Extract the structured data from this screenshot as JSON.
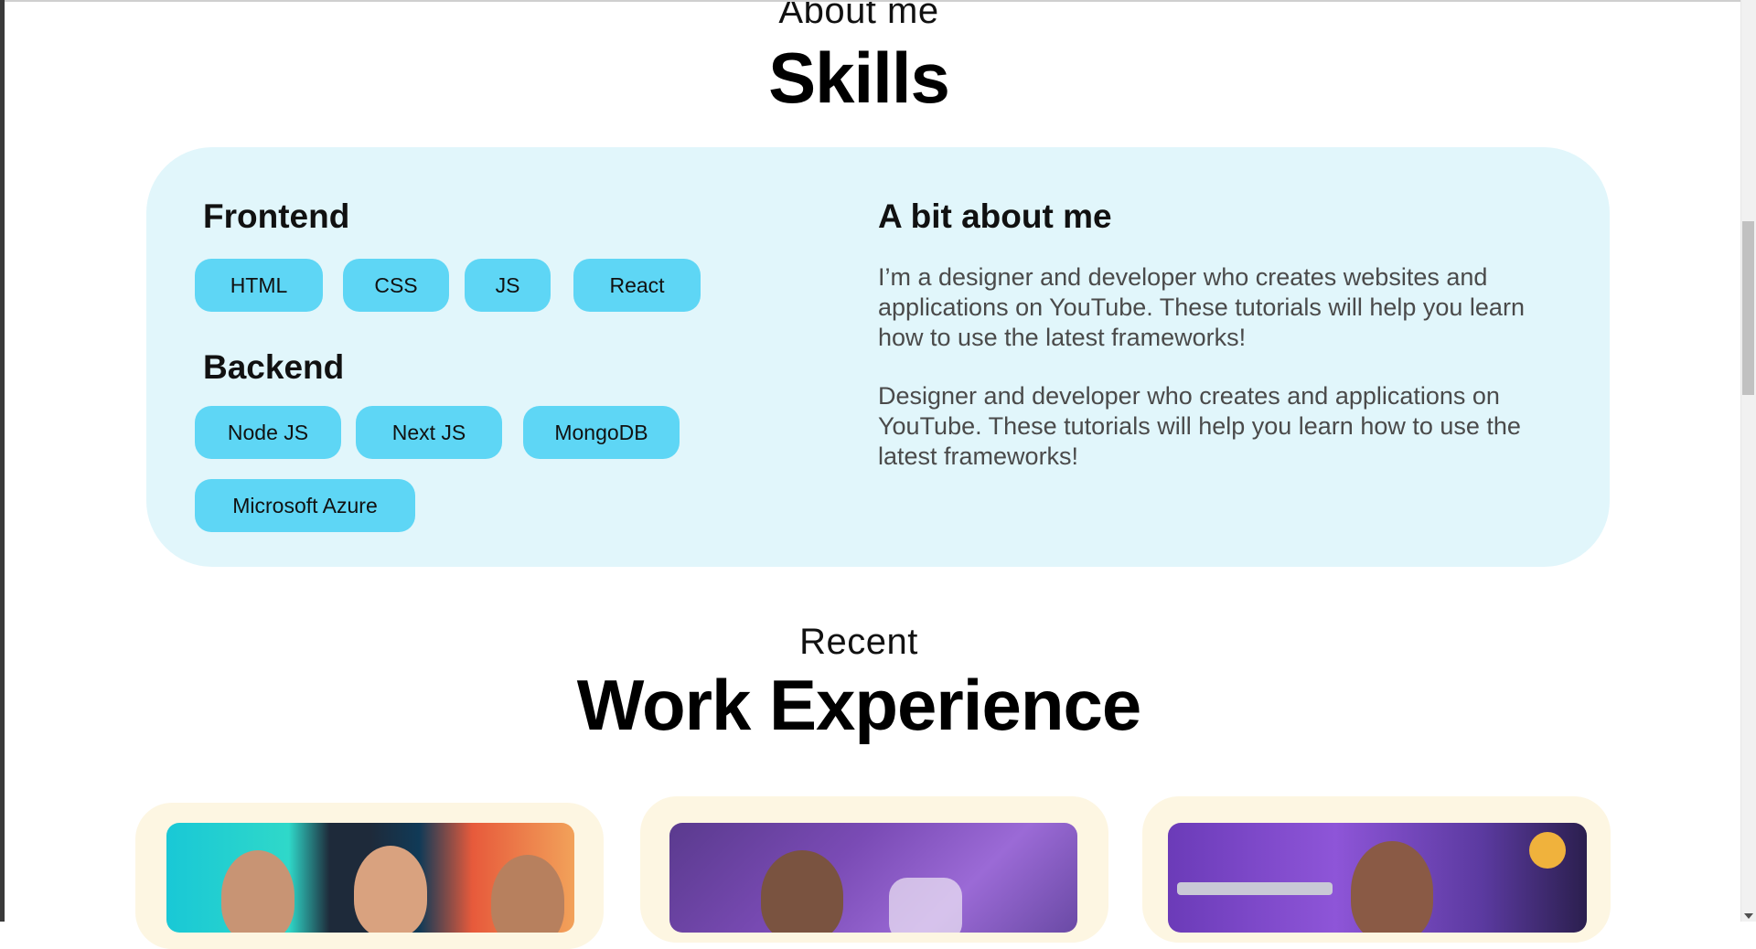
{
  "about": {
    "eyebrow": "About me",
    "title": "Skills"
  },
  "skills": {
    "frontend": {
      "heading": "Frontend",
      "items": [
        "HTML",
        "CSS",
        "JS",
        "React"
      ]
    },
    "backend": {
      "heading": "Backend",
      "items": [
        "Node JS",
        "Next JS",
        "MongoDB",
        "Microsoft Azure"
      ]
    }
  },
  "bio": {
    "heading": "A bit about me",
    "paragraphs": [
      "I’m a designer and developer who creates websites and applications on YouTube.  These tutorials will help you learn how to use the latest frameworks!",
      "Designer and developer who creates and applications on YouTube.  These tutorials will help you learn how to use the latest frameworks!"
    ]
  },
  "work": {
    "eyebrow": "Recent",
    "title": "Work Experience"
  },
  "colors": {
    "panel_bg": "#e1f6fb",
    "pill_bg": "#5ed6f5",
    "card_bg": "#fdf6e2"
  }
}
